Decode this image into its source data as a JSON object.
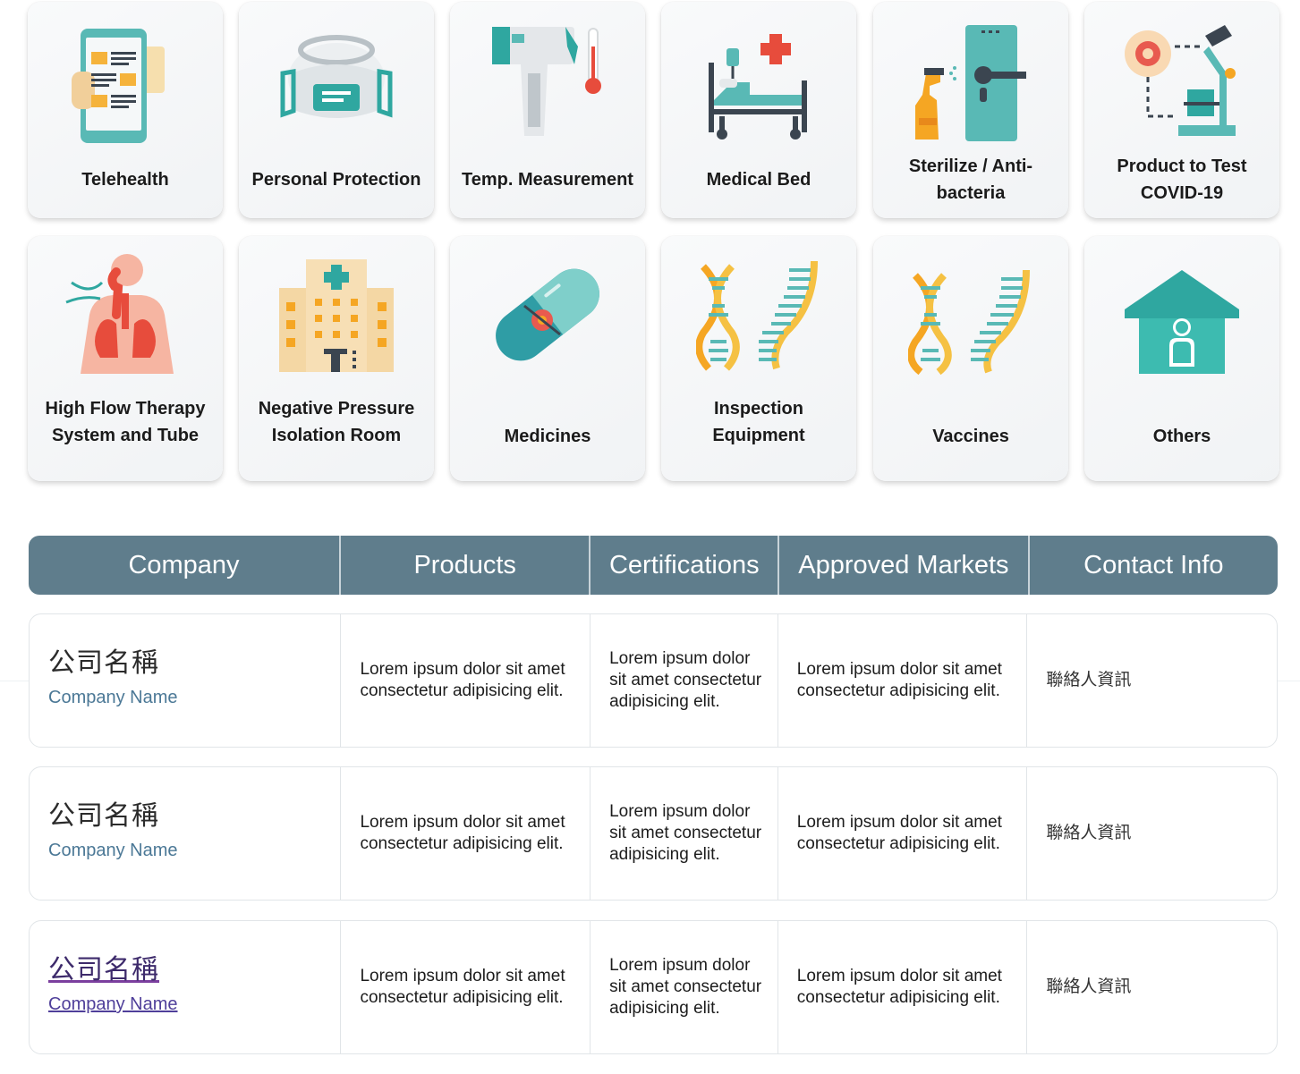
{
  "categories": [
    {
      "label": "Telehealth",
      "icon": "telehealth-phone-icon"
    },
    {
      "label": "Personal Protection",
      "icon": "face-mask-icon"
    },
    {
      "label": "Temp. Measurement",
      "icon": "thermometer-gun-icon"
    },
    {
      "label": "Medical Bed",
      "icon": "hospital-bed-icon"
    },
    {
      "label": "Sterilize / Anti-bacteria",
      "icon": "sanitizer-door-icon"
    },
    {
      "label": "Product to Test COVID-19",
      "icon": "microscope-virus-icon"
    },
    {
      "label": "High Flow Therapy System and Tube",
      "icon": "lungs-respiratory-icon"
    },
    {
      "label": "Negative Pressure Isolation Room",
      "icon": "hospital-building-icon"
    },
    {
      "label": "Medicines",
      "icon": "capsule-pill-icon"
    },
    {
      "label": "Inspection Equipment",
      "icon": "dna-helix-icon"
    },
    {
      "label": "Vaccines",
      "icon": "dna-helix-icon"
    },
    {
      "label": "Others",
      "icon": "house-person-icon"
    }
  ],
  "table": {
    "headers": [
      "Company",
      "Products",
      "Certifications",
      "Approved Markets",
      "Contact Info"
    ],
    "rows": [
      {
        "company_cn": "公司名稱",
        "company_en": "Company Name",
        "products": "Lorem ipsum dolor sit amet consectetur adipisicing elit.",
        "certifications": "Lorem ipsum dolor sit amet consectetur adipisicing elit.",
        "markets": "Lorem ipsum dolor sit amet consectetur adipisicing elit.",
        "contact": "聯絡人資訊"
      },
      {
        "company_cn": "公司名稱",
        "company_en": "Company Name",
        "products": "Lorem ipsum dolor sit amet consectetur adipisicing elit.",
        "certifications": "Lorem ipsum dolor sit amet consectetur adipisicing elit.",
        "markets": "Lorem ipsum dolor sit amet consectetur adipisicing elit.",
        "contact": "聯絡人資訊"
      },
      {
        "company_cn": "公司名稱",
        "company_en": "Company Name",
        "products": "Lorem ipsum dolor sit amet consectetur adipisicing elit.",
        "certifications": "Lorem ipsum dolor sit amet consectetur adipisicing elit.",
        "markets": "Lorem ipsum dolor sit amet consectetur adipisicing elit.",
        "contact": "聯絡人資訊"
      }
    ]
  },
  "colors": {
    "header_bg": "#5f7d8c",
    "teal": "#3fb5b0",
    "orange": "#f5a623",
    "red": "#e74c3c",
    "link": "#4b7896"
  }
}
